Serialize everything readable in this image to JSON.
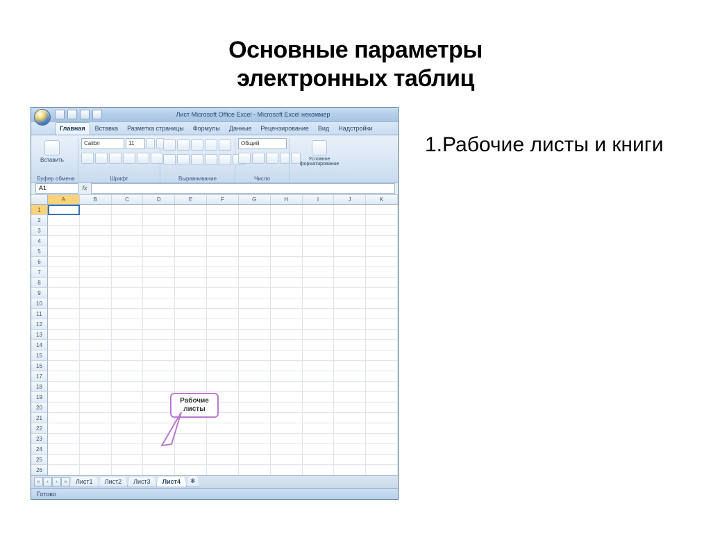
{
  "slide": {
    "title_line1": "Основные параметры",
    "title_line2": "электронных таблиц",
    "bullet": "1.Рабочие листы и книги"
  },
  "window": {
    "title": "Лист Microsoft Office Excel - Microsoft Excel некоммер"
  },
  "tabs": {
    "home": "Главная",
    "insert": "Вставка",
    "layout": "Разметка страницы",
    "formulas": "Формулы",
    "data": "Данные",
    "review": "Рецензирование",
    "view": "Вид",
    "addins": "Надстройки"
  },
  "ribbon": {
    "clipboard_label": "Буфер обмена",
    "paste": "Вставить",
    "font_label": "Шрифт",
    "font_name": "Calibri",
    "font_size": "11",
    "align_label": "Выравнивание",
    "number_label": "Число",
    "number_format": "Общий",
    "cond_format": "Условное форматирование"
  },
  "namebox": "A1",
  "columns": [
    "A",
    "B",
    "C",
    "D",
    "E",
    "F",
    "G",
    "H",
    "I",
    "J",
    "K"
  ],
  "row_count": 26,
  "callout": {
    "line1": "Рабочие",
    "line2": "листы"
  },
  "sheets": {
    "s1": "Лист1",
    "s2": "Лист2",
    "s3": "Лист3",
    "s4": "Лист4"
  },
  "status": "Готово"
}
